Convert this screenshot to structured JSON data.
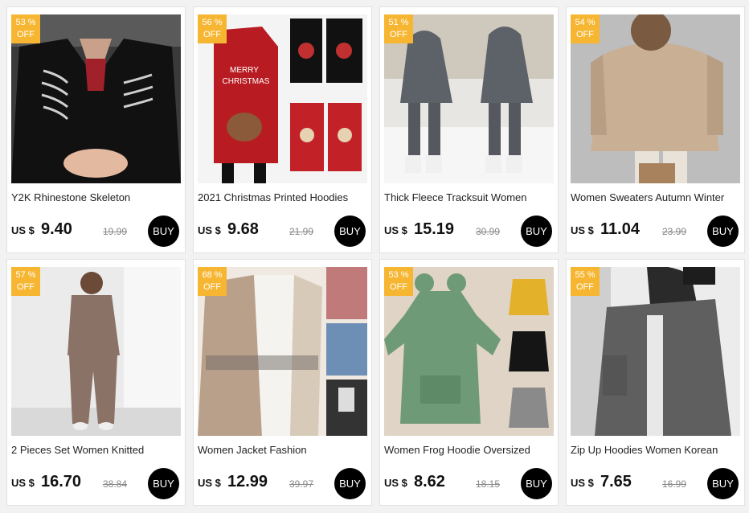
{
  "products": [
    {
      "discount_pct": "53 %",
      "discount_off": "OFF",
      "title": "Y2K Rhinestone Skeleton",
      "currency": "US $",
      "price": "9.40",
      "original_price": "19.99",
      "buy_label": "BUY",
      "image": "black-hoodie-skeleton"
    },
    {
      "discount_pct": "56 %",
      "discount_off": "OFF",
      "title": "2021 Christmas Printed Hoodies",
      "currency": "US $",
      "price": "9.68",
      "original_price": "21.99",
      "buy_label": "BUY",
      "image": "christmas-hoodie-dress"
    },
    {
      "discount_pct": "51 %",
      "discount_off": "OFF",
      "title": "Thick Fleece Tracksuit Women",
      "currency": "US $",
      "price": "15.19",
      "original_price": "30.99",
      "buy_label": "BUY",
      "image": "gray-fleece-tracksuit"
    },
    {
      "discount_pct": "54 %",
      "discount_off": "OFF",
      "title": "Women Sweaters Autumn Winter",
      "currency": "US $",
      "price": "11.04",
      "original_price": "23.99",
      "buy_label": "BUY",
      "image": "beige-knit-sweater"
    },
    {
      "discount_pct": "57 %",
      "discount_off": "OFF",
      "title": "2 Pieces Set Women Knitted",
      "currency": "US $",
      "price": "16.70",
      "original_price": "38.84",
      "buy_label": "BUY",
      "image": "brown-knit-set"
    },
    {
      "discount_pct": "68 %",
      "discount_off": "OFF",
      "title": "Women Jacket Fashion",
      "currency": "US $",
      "price": "12.99",
      "original_price": "39.97",
      "buy_label": "BUY",
      "image": "patchwork-fleece-jacket"
    },
    {
      "discount_pct": "53 %",
      "discount_off": "OFF",
      "title": "Women Frog Hoodie Oversized",
      "currency": "US $",
      "price": "8.62",
      "original_price": "18.15",
      "buy_label": "BUY",
      "image": "green-frog-hoodie"
    },
    {
      "discount_pct": "55 %",
      "discount_off": "OFF",
      "title": "Zip Up Hoodies Women Korean",
      "currency": "US $",
      "price": "7.65",
      "original_price": "16.99",
      "buy_label": "BUY",
      "image": "gray-zip-hoodie"
    }
  ]
}
